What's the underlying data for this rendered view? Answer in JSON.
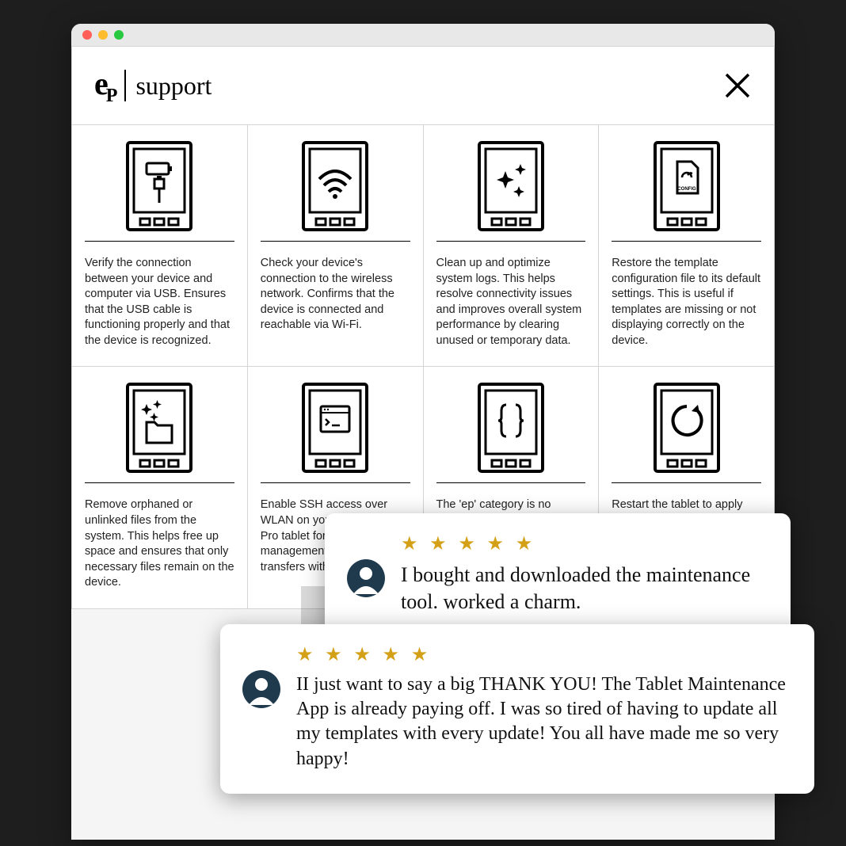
{
  "header": {
    "brand_text": "support"
  },
  "cards": {
    "c0": "Verify the connection between your device and computer via USB. Ensures that the USB cable is functioning properly and that the device is recognized.",
    "c1": "Check your device's connection to the wireless network. Confirms that the device is connected and reachable via Wi-Fi.",
    "c2": "Clean up and optimize system logs. This helps resolve connectivity issues and improves overall system performance by clearing unused or temporary data.",
    "c3": "Restore the template configuration file to its default settings. This is useful if templates are missing or not displaying correctly on the device.",
    "c4": "Remove orphaned or unlinked files from the system. This helps free up space and ensures that only necessary files remain on the device.",
    "c5": "Enable SSH access over WLAN on your reMarkable Pro tablet for secure remote management and file transfers without USB.",
    "c6": "The 'ep' category is no longer visible on rM 1 & rM 2 after the latest update.",
    "c7": "Restart the tablet to apply recent changes or troubleshoot issues."
  },
  "reviews": {
    "r1": {
      "stars": "★ ★ ★ ★ ★",
      "text": "I bought and downloaded the maintenance tool. worked a charm."
    },
    "r2": {
      "stars": "★ ★ ★ ★ ★",
      "text": "II just want to say a big THANK YOU! The Tablet Maintenance App is already paying off. I was so tired of having to update all my templates with every update! You all have made me so very happy!"
    }
  },
  "icons": {
    "config_label": "CONFIG"
  }
}
